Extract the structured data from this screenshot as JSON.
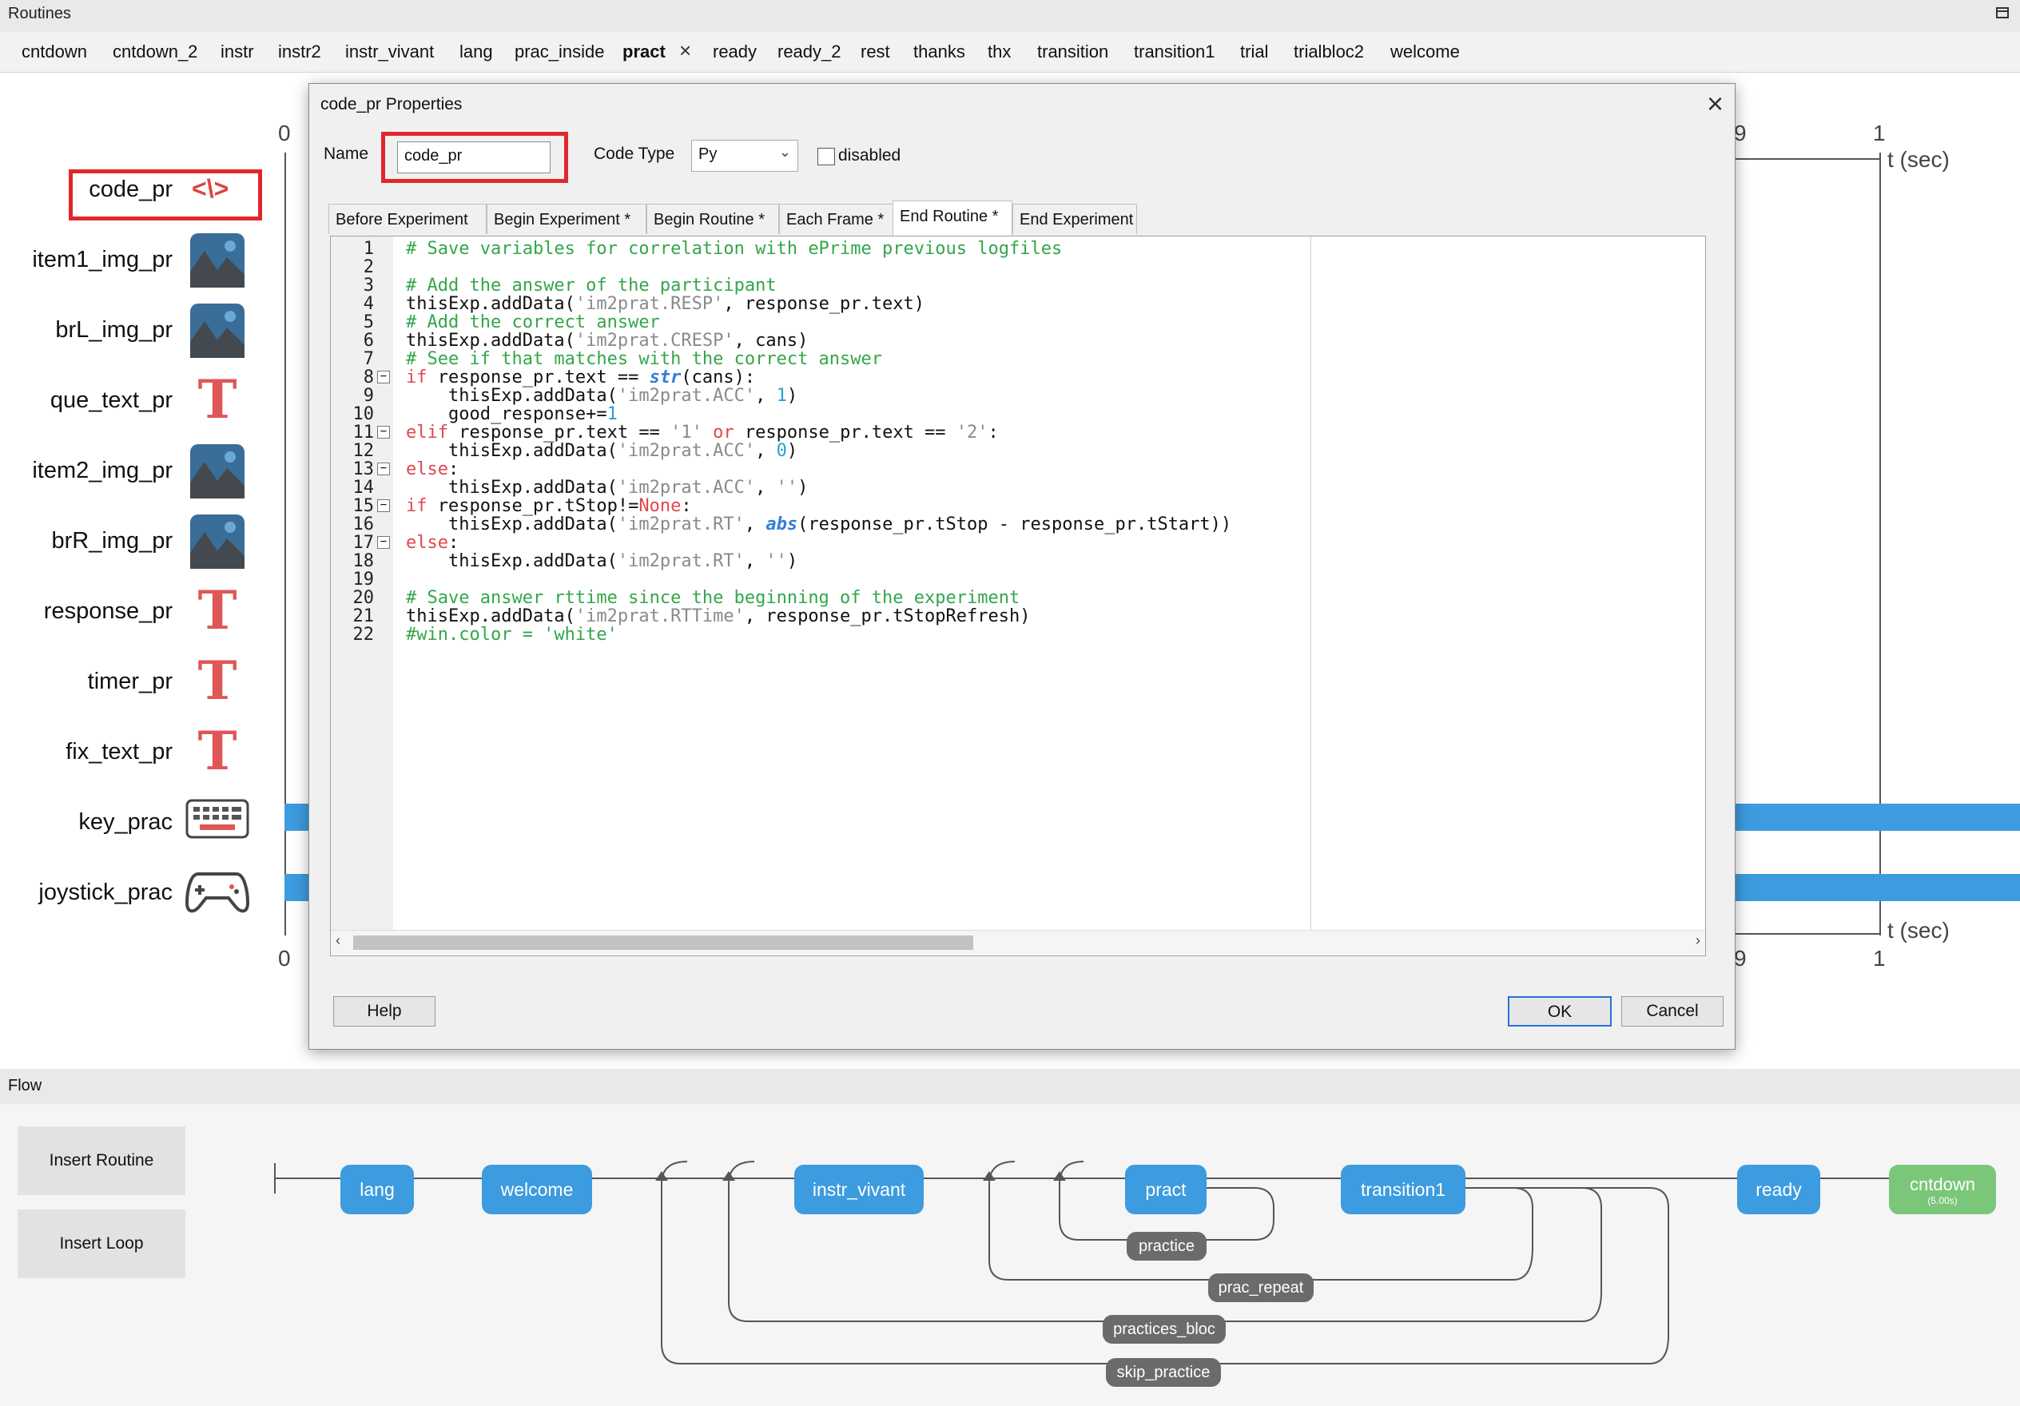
{
  "routines_panel": {
    "title": "Routines",
    "tabs": [
      "cntdown",
      "cntdown_2",
      "instr",
      "instr2",
      "instr_vivant",
      "lang",
      "prac_inside",
      "pract",
      "ready",
      "ready_2",
      "rest",
      "thanks",
      "thx",
      "transition",
      "transition1",
      "trial",
      "trialbloc2",
      "welcome"
    ],
    "active_tab": "pract"
  },
  "timeline": {
    "components": [
      {
        "label": "code_pr",
        "icon": "code-icon"
      },
      {
        "label": "item1_img_pr",
        "icon": "image-icon"
      },
      {
        "label": "brL_img_pr",
        "icon": "image-icon"
      },
      {
        "label": "que_text_pr",
        "icon": "text-icon"
      },
      {
        "label": "item2_img_pr",
        "icon": "image-icon"
      },
      {
        "label": "brR_img_pr",
        "icon": "image-icon"
      },
      {
        "label": "response_pr",
        "icon": "text-icon"
      },
      {
        "label": "timer_pr",
        "icon": "text-icon"
      },
      {
        "label": "fix_text_pr",
        "icon": "text-icon"
      },
      {
        "label": "key_prac",
        "icon": "keyboard-icon"
      },
      {
        "label": "joystick_prac",
        "icon": "joystick-icon"
      }
    ],
    "axis_start_top": "0",
    "axis_start_bottom": "0",
    "axis_partial_top": "9",
    "axis_partial_bottom": "9",
    "axis_end_top": "1",
    "axis_end_bottom": "1",
    "axis_unit_top": "t (sec)",
    "axis_unit_bottom": "t (sec)"
  },
  "dialog": {
    "title": "code_pr Properties",
    "name_label": "Name",
    "name_value": "code_pr",
    "code_type_label": "Code Type",
    "code_type_value": "Py",
    "disabled_label": "disabled",
    "tabs": [
      "Before Experiment",
      "Begin Experiment *",
      "Begin Routine *",
      "Each Frame *",
      "End Routine *",
      "End Experiment"
    ],
    "active_tab": "End Routine *",
    "code_lines": [
      "# Save variables for correlation with ePrime previous logfiles",
      "",
      "# Add the answer of the participant",
      "thisExp.addData('im2prat.RESP', response_pr.text)",
      "# Add the correct answer",
      "thisExp.addData('im2prat.CRESP', cans)",
      "# See if that matches with the correct answer",
      "if response_pr.text == str(cans):",
      "    thisExp.addData('im2prat.ACC', 1)",
      "    good_response+=1",
      "elif response_pr.text == '1' or response_pr.text == '2':",
      "    thisExp.addData('im2prat.ACC', 0)",
      "else:",
      "    thisExp.addData('im2prat.ACC', '')",
      "if response_pr.tStop!=None:",
      "    thisExp.addData('im2prat.RT', abs(response_pr.tStop - response_pr.tStart))",
      "else:",
      "    thisExp.addData('im2prat.RT', '')",
      "",
      "# Save answer rttime since the beginning of the experiment",
      "thisExp.addData('im2prat.RTTime', response_pr.tStopRefresh)",
      "#win.color = 'white'"
    ],
    "help_label": "Help",
    "ok_label": "OK",
    "cancel_label": "Cancel"
  },
  "flow_panel": {
    "title": "Flow",
    "insert_routine_label": "Insert Routine",
    "insert_loop_label": "Insert Loop",
    "routines": [
      "lang",
      "welcome",
      "instr_vivant",
      "pract",
      "transition1",
      "ready",
      "cntdown"
    ],
    "cntdown_duration": "(5.00s)",
    "loops": [
      "practice",
      "prac_repeat",
      "practices_bloc",
      "skip_practice"
    ]
  },
  "colors": {
    "accent_blue": "#3d9bdf",
    "highlight_red": "#e0282b",
    "flow_green": "#7ac77a",
    "loop_gray": "#6b6b6b"
  }
}
